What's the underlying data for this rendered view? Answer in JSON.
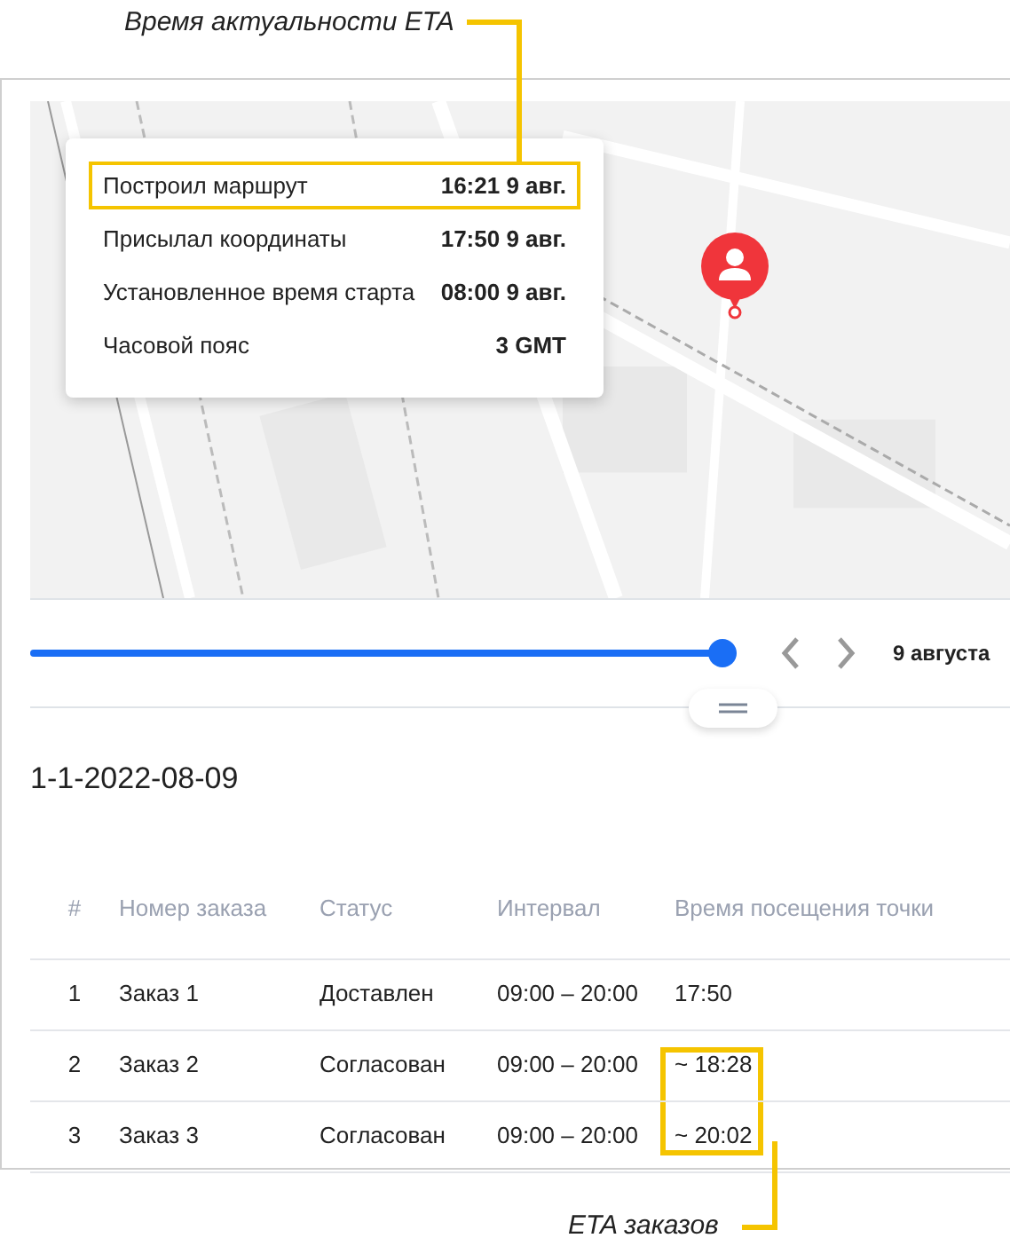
{
  "annotations": [
    {
      "text": "Время актуальности ETA"
    },
    {
      "text": "ETA заказов"
    }
  ],
  "popup": {
    "rows": [
      {
        "label": "Построил маршрут",
        "value": "16:21 9 авг.",
        "highlighted": true
      },
      {
        "label": "Присылал координаты",
        "value": "17:50 9 авг.",
        "highlighted": false
      },
      {
        "label": "Установленное время старта",
        "value": "08:00 9 авг.",
        "highlighted": false
      },
      {
        "label": "Часовой пояс",
        "value": "3 GMT",
        "highlighted": false
      }
    ]
  },
  "timeline": {
    "level": 1,
    "date": "9 августа"
  },
  "route_title": "1-1-2022-08-09",
  "table": {
    "columns": [
      "#",
      "Номер заказа",
      "Статус",
      "Интервал",
      "Время посещения точки"
    ],
    "rows": [
      {
        "cells": [
          "1",
          "Заказ 1",
          "Доставлен",
          "09:00 – 20:00",
          "17:50"
        ],
        "highlighted": false
      },
      {
        "cells": [
          "2",
          "Заказ 2",
          "Согласован",
          "09:00 – 20:00",
          "~ 18:28"
        ],
        "highlighted": true
      },
      {
        "cells": [
          "3",
          "Заказ 3",
          "Согласован",
          "09:00 – 20:00",
          "~ 20:02"
        ],
        "highlighted": true
      }
    ]
  }
}
